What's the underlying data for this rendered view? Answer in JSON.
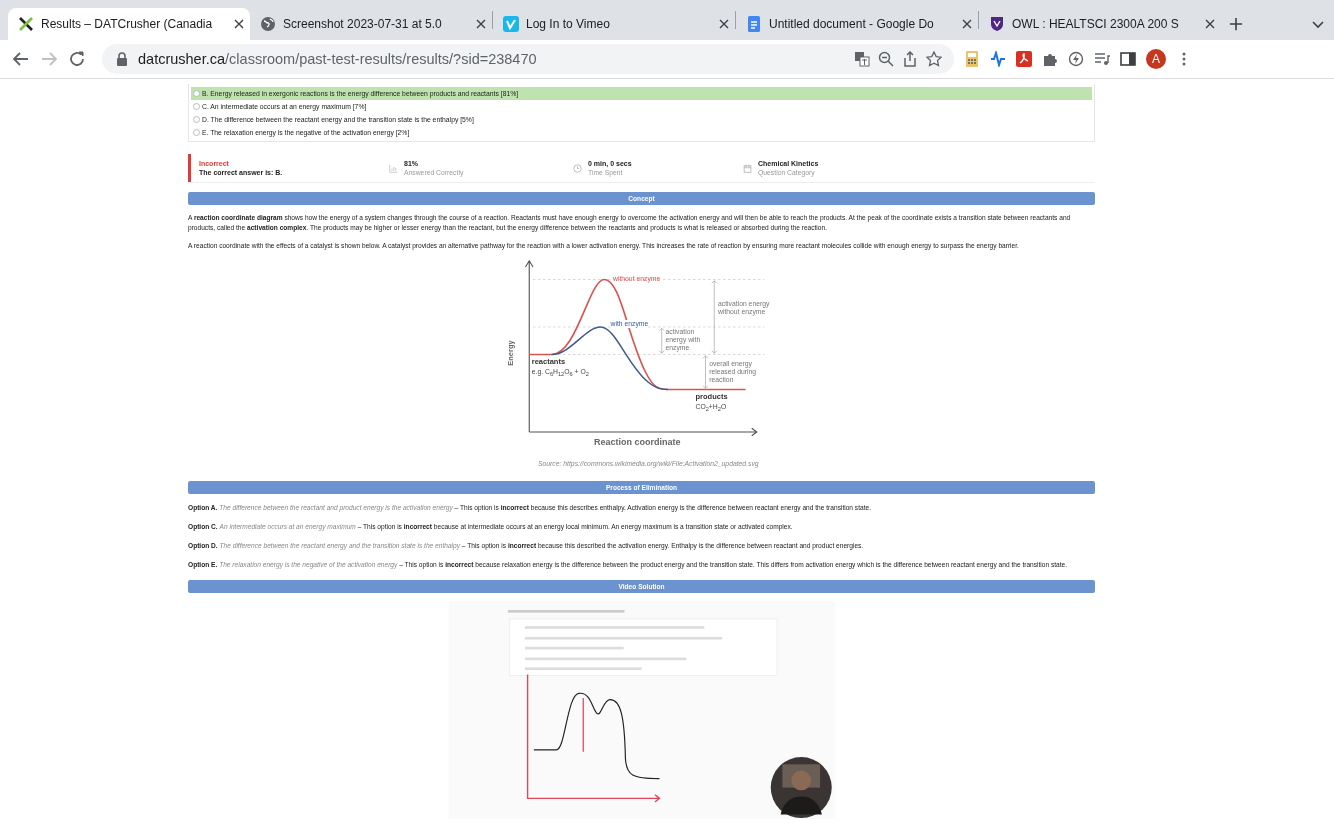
{
  "browser": {
    "tabs": [
      {
        "title": "Results – DATCrusher (Canadia",
        "selected": true
      },
      {
        "title": "Screenshot 2023-07-31 at 5.0",
        "selected": false
      },
      {
        "title": "Log In to Vimeo",
        "selected": false
      },
      {
        "title": "Untitled document - Google Do",
        "selected": false
      },
      {
        "title": "OWL : HEALTSCI 2300A 200 S",
        "selected": false
      }
    ],
    "address": {
      "host": "datcrusher.ca",
      "path": "/classroom/past-test-results/results/?sid=238470"
    },
    "profile_initial": "A"
  },
  "answers": [
    {
      "text": "B. Energy released in exergonic reactions is the energy difference between products and reactants [81%]",
      "correct": true
    },
    {
      "text": "C. An intermediate occurs at an energy maximum [7%]",
      "correct": false
    },
    {
      "text": "D. The difference between the reactant energy and the transition state is the enthalpy [5%]",
      "correct": false
    },
    {
      "text": "E. The relaxation energy is the negative of the activation energy [2%]",
      "correct": false
    }
  ],
  "result": {
    "status": "Incorrect",
    "note": "The correct answer is: B.",
    "stats": [
      {
        "kind": "chart",
        "value": "81%",
        "label": "Answered Correctly"
      },
      {
        "kind": "clock",
        "value": "0 min, 0 secs",
        "label": "Time Spent"
      },
      {
        "kind": "calendar",
        "value": "Chemical Kinetics",
        "label": "Question Category"
      }
    ]
  },
  "concept": {
    "heading": "Concept",
    "paragraphs": [
      "A **reaction coordinate diagram** shows how the energy of a system changes through the course of a reaction. Reactants must have enough energy to overcome the activation energy and will then be able to reach the products. At the peak of the coordinate exists a transition state between reactants and products, called the **activation complex**. The products may be higher or lesser energy than the reactant, but the energy difference between the reactants and products is what is released or absorbed during the reaction.",
      "A reaction coordinate with the effects of a catalyst is shown below. A catalyst provides an alternative pathway for the reaction with a lower activation energy. This increases the rate of reaction by ensuring more reactant molecules collide with enough energy to surpass the energy barrier."
    ],
    "figure": {
      "y_label": "Energy",
      "x_label": "Reaction coordinate",
      "without_label": "without enzyme",
      "with_label": "with enzyme",
      "act_without": "activation energy without enzyme",
      "act_with": "activation energy with enzyme",
      "overall": "overall energy released during reaction",
      "reactants": "reactants",
      "reactants_example": "e.g. C$_{6}$H$_{12}$O$_{6}$ + O$_{2}$",
      "products": "products",
      "products_example": "CO$_{2}$+H$_{2}$O",
      "source": "Source: https://commons.wikimedia.org/wiki/File:Activation2_updated.svg"
    }
  },
  "elimination": {
    "heading": "Process of Elimination",
    "options": [
      {
        "label": "Option A.",
        "quote": "The difference between the reactant and product energy is the activation energy",
        "text": " – This option is **incorrect** because this describes enthalpy. Activation energy is the difference between reactant energy and the transition state."
      },
      {
        "label": "Option C.",
        "quote": "An intermediate occurs at an energy maximum",
        "text": " – This option is **incorrect** because at intermediate occurs at an energy local minimum. An energy maximum is a transition state or activated complex."
      },
      {
        "label": "Option D.",
        "quote": "The difference between the reactant energy and the transition state is the enthalpy",
        "text": " – This option is **incorrect** because this described the activation energy. Enthalpy is the difference between reactant and product energies."
      },
      {
        "label": "Option E.",
        "quote": "The relaxation energy is the negative of the activation energy",
        "text": " – This option is **incorrect** because relaxation energy is the difference between the product energy and the transition state. This differs from activation energy which is the difference between reactant energy and the transition state."
      }
    ]
  },
  "video": {
    "heading": "Video Solution",
    "kind": "picture"
  }
}
